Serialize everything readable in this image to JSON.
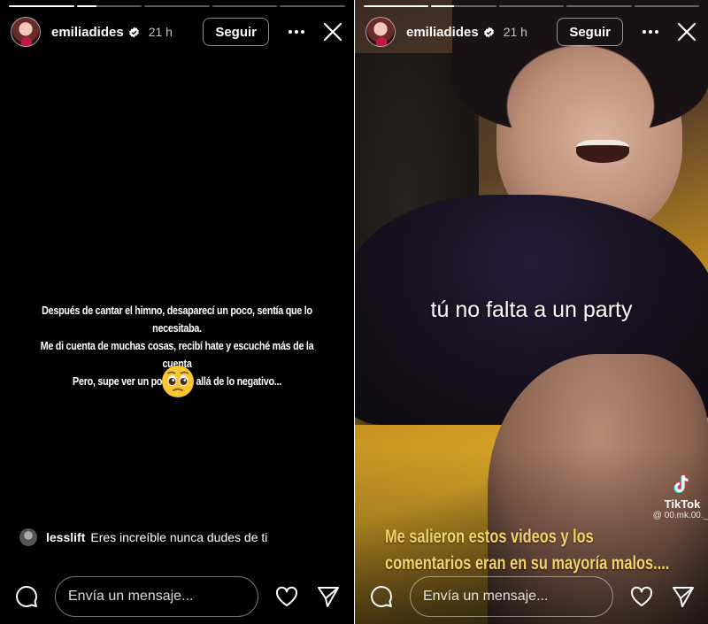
{
  "colors": {
    "story_bg": "#000000",
    "caption_yellow": "#f2d36a",
    "text": "#ffffff"
  },
  "stories": [
    {
      "progress": [
        1,
        0.3,
        0,
        0,
        0
      ],
      "header": {
        "username": "emiliadides",
        "time": "21 h",
        "follow_label": "Seguir",
        "more_icon": "more-icon",
        "close_icon": "close-icon"
      },
      "text_lines": [
        "Después de cantar el himno, desaparecí un poco, sentía que lo necesitaba.",
        "Me di cuenta de muchas cosas, recibí hate y escuché más de la cuenta",
        "Pero, supe ver un poco más allá de lo negativo..."
      ],
      "emoji": "pleading-face-emoji",
      "comment": {
        "user": "lesslift",
        "text": "Eres increíble nunca dudes de ti"
      },
      "footer": {
        "message_placeholder": "Envía un mensaje..."
      }
    },
    {
      "progress": [
        1,
        0.35,
        0,
        0,
        0
      ],
      "header": {
        "username": "emiliadides",
        "time": "21 h",
        "follow_label": "Seguir"
      },
      "overlay_text": "tú no falta a un party",
      "tiktok": {
        "brand": "TikTok",
        "handle": "@ 00.mk.00._"
      },
      "caption_lines": [
        "Me salieron estos videos y los",
        "comentarios eran en su mayoría malos...."
      ],
      "footer": {
        "message_placeholder": "Envía un mensaje..."
      }
    }
  ]
}
